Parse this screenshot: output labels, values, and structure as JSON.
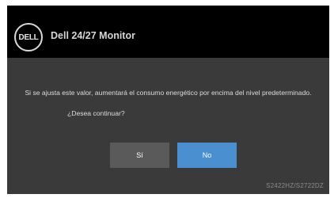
{
  "header": {
    "logo_text": "DELL",
    "title": "Dell 24/27 Monitor"
  },
  "dialog": {
    "message": "Si se ajusta este valor, aumentará el consumo energético por encima del nivel predeterminado.",
    "question": "¿Desea continuar?",
    "yes_label": "Sí",
    "no_label": "No"
  },
  "footer": {
    "model": "S2422HZ/S2722DZ"
  },
  "colors": {
    "header_bg": "#000000",
    "panel_bg": "#3a3a3a",
    "yes_button": "#5a5a5a",
    "no_button_selected": "#4a8fcf"
  }
}
